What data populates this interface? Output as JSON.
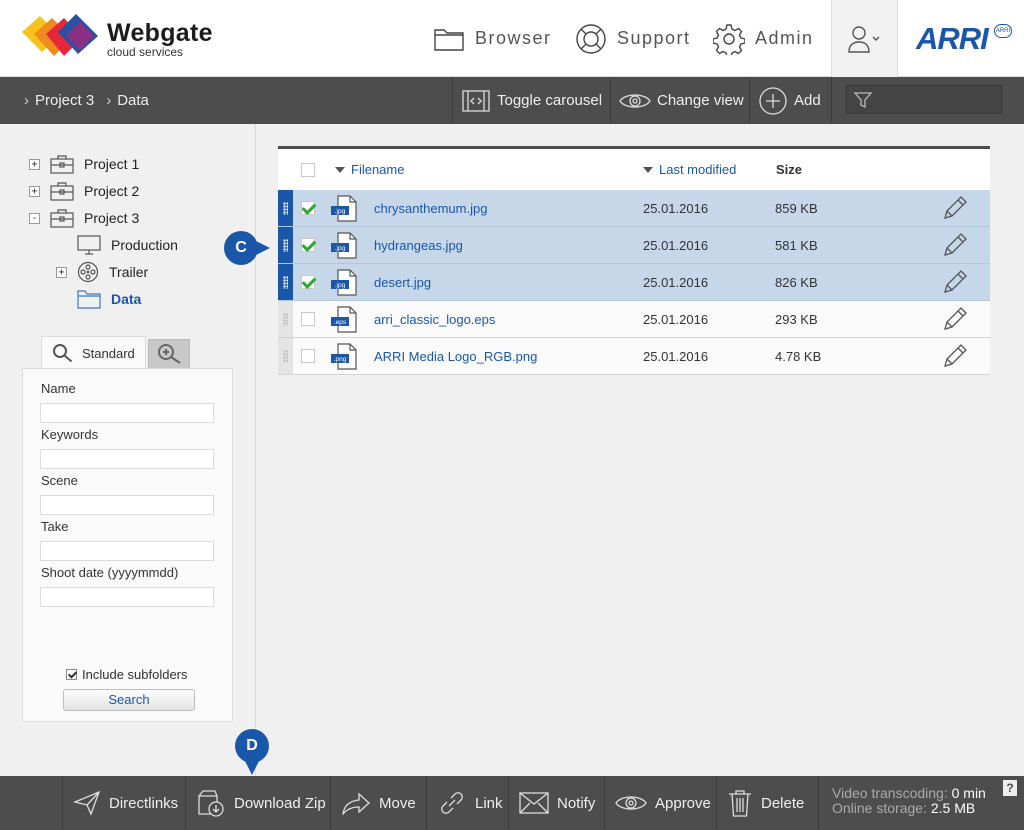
{
  "header": {
    "brand_name": "Webgate",
    "brand_sub": "cloud services",
    "nav": [
      {
        "label": "Browser",
        "icon": "folder-icon"
      },
      {
        "label": "Support",
        "icon": "lifebuoy-icon"
      },
      {
        "label": "Admin",
        "icon": "gear-icon"
      }
    ],
    "partner_logo": "ARRI",
    "partner_badge": "ARRI"
  },
  "toolbar": {
    "breadcrumb": [
      "Project 3",
      "Data"
    ],
    "toggle_carousel": "Toggle carousel",
    "change_view": "Change view",
    "add": "Add",
    "filter_placeholder": ""
  },
  "tree": [
    {
      "label": "Project 1",
      "toggle": "+"
    },
    {
      "label": "Project 2",
      "toggle": "+"
    },
    {
      "label": "Project 3",
      "toggle": "-"
    },
    {
      "label": "Production",
      "toggle": ""
    },
    {
      "label": "Trailer",
      "toggle": "+"
    },
    {
      "label": "Data",
      "toggle": ""
    }
  ],
  "search": {
    "tab_standard": "Standard",
    "fields": [
      {
        "label": "Name",
        "value": ""
      },
      {
        "label": "Keywords",
        "value": ""
      },
      {
        "label": "Scene",
        "value": ""
      },
      {
        "label": "Take",
        "value": ""
      },
      {
        "label": "Shoot date (yyyymmdd)",
        "value": ""
      }
    ],
    "include_subfolders": "Include subfolders",
    "include_subfolders_checked": true,
    "search_button": "Search"
  },
  "table": {
    "columns": {
      "filename": "Filename",
      "modified": "Last modified",
      "size": "Size"
    },
    "rows": [
      {
        "name": "chrysanthemum.jpg",
        "ext": ".jpg",
        "date": "25.01.2016",
        "size": "859 KB",
        "selected": true
      },
      {
        "name": "hydrangeas.jpg",
        "ext": ".jpg",
        "date": "25.01.2016",
        "size": "581 KB",
        "selected": true
      },
      {
        "name": "desert.jpg",
        "ext": ".jpg",
        "date": "25.01.2016",
        "size": "826 KB",
        "selected": true
      },
      {
        "name": "arri_classic_logo.eps",
        "ext": ".eps",
        "date": "25.01.2016",
        "size": "293 KB",
        "selected": false
      },
      {
        "name": "ARRI Media Logo_RGB.png",
        "ext": ".png",
        "date": "25.01.2016",
        "size": "4.78 KB",
        "selected": false
      }
    ]
  },
  "callouts": {
    "c": "C",
    "d": "D"
  },
  "bottombar": {
    "directlinks": "Directlinks",
    "download_zip": "Download Zip",
    "move": "Move",
    "link": "Link",
    "notify": "Notify",
    "approve": "Approve",
    "delete": "Delete",
    "status": {
      "transcoding_label": "Video transcoding:",
      "transcoding_value": "0 min",
      "storage_label": "Online storage:",
      "storage_value": "2.5 MB"
    },
    "help": "?"
  },
  "colors": {
    "accent": "#1a57a8",
    "selected_row": "#c5d7e9",
    "bar": "#4d4d4d",
    "check": "#27a82a"
  }
}
